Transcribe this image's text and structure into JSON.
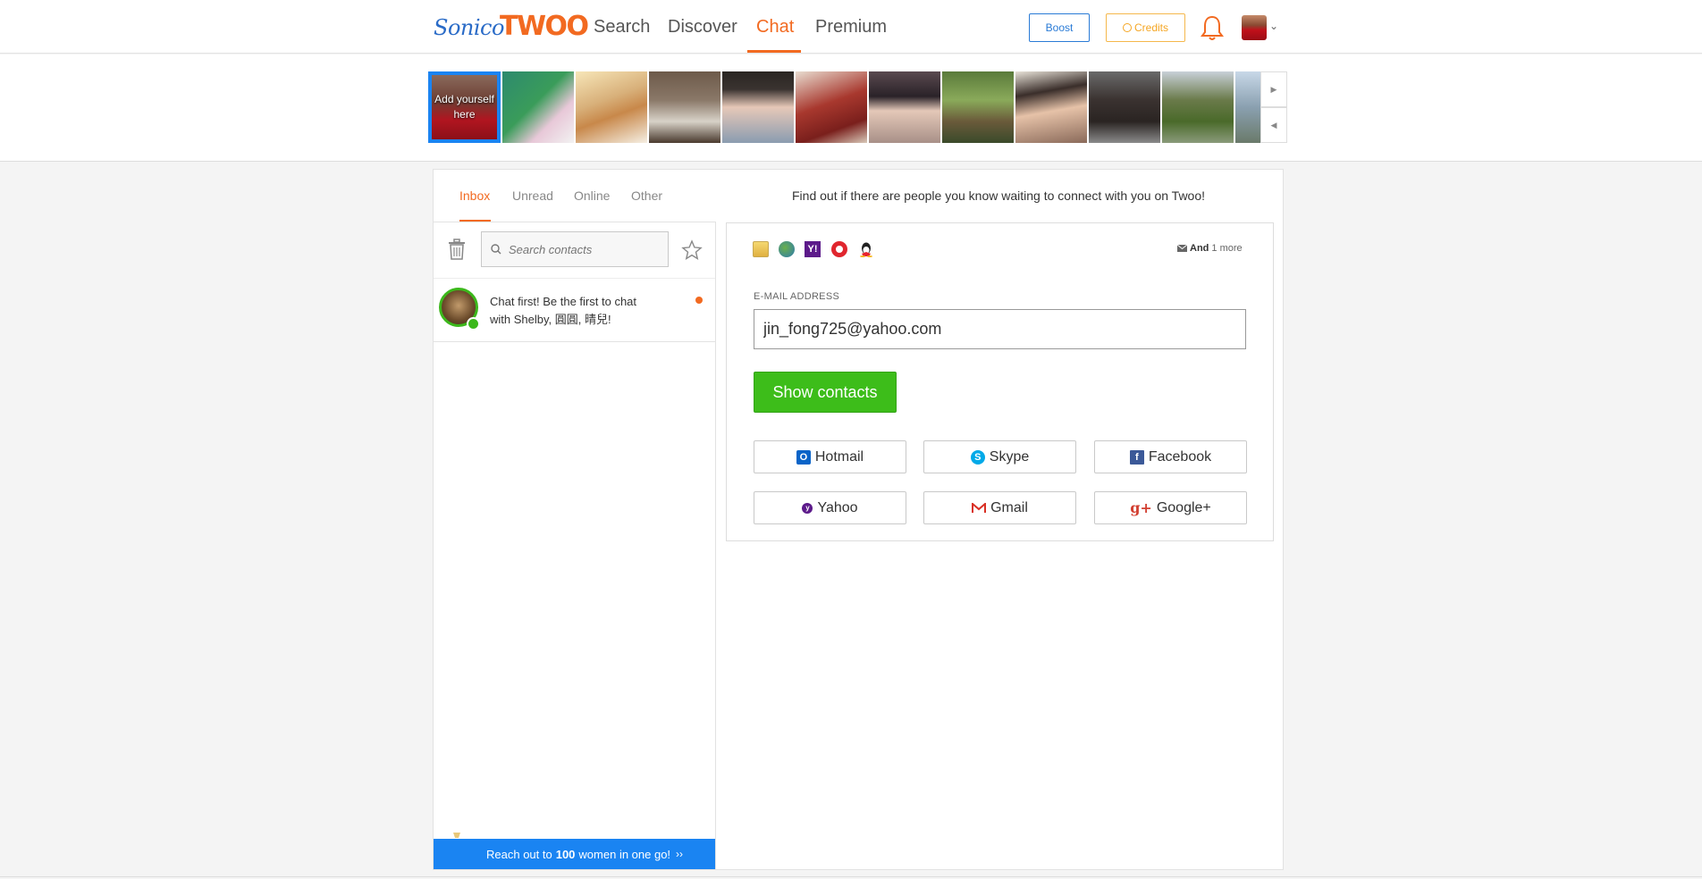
{
  "header": {
    "logo_sonico": "Sonico",
    "logo_twoo": "TWOO",
    "nav": [
      "Search",
      "Discover",
      "Chat",
      "Premium"
    ],
    "active_nav": "Chat",
    "boost_label": "Boost",
    "credits_label": "Credits"
  },
  "strip": {
    "add_yourself": "Add yourself here"
  },
  "tabs": [
    "Inbox",
    "Unread",
    "Online",
    "Other"
  ],
  "active_tab": "Inbox",
  "promo_text": "Find out if there are people you know waiting to connect with you on Twoo!",
  "search": {
    "placeholder": "Search contacts"
  },
  "chat_item": {
    "text": "Chat first! Be the first to chat with Shelby, 圓圓, 晴兒!"
  },
  "reach": {
    "prefix": "Reach out to",
    "count": "100",
    "suffix": "women in one go!",
    "arrow": "››"
  },
  "import": {
    "and_label": "And",
    "more_label": "1 more",
    "email_label": "E-MAIL ADDRESS",
    "email_value": "jin_fong725@yahoo.com",
    "show_button": "Show contacts",
    "services": [
      "Hotmail",
      "Skype",
      "Facebook",
      "Yahoo",
      "Gmail",
      "Google+"
    ]
  },
  "colors": {
    "accent": "#f26a21",
    "blue": "#1a84f2",
    "green": "#3dbd1a"
  }
}
